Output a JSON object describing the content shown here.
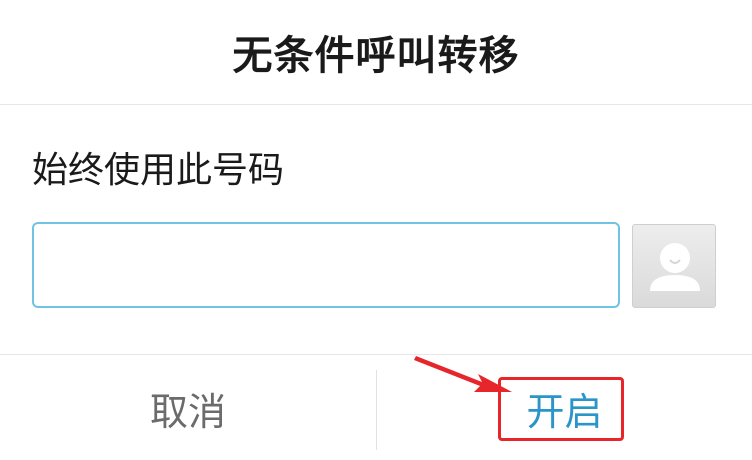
{
  "dialog": {
    "title": "无条件呼叫转移",
    "field_label": "始终使用此号码",
    "phone_input": {
      "value": "",
      "placeholder": ""
    },
    "contact_picker_icon": "contact-avatar-icon",
    "cancel_label": "取消",
    "enable_label": "开启"
  },
  "colors": {
    "input_border": "#6fc3e3",
    "enable_text": "#2a95c8",
    "cancel_text": "#6b6b6b",
    "annotation_red": "#e6262b"
  }
}
